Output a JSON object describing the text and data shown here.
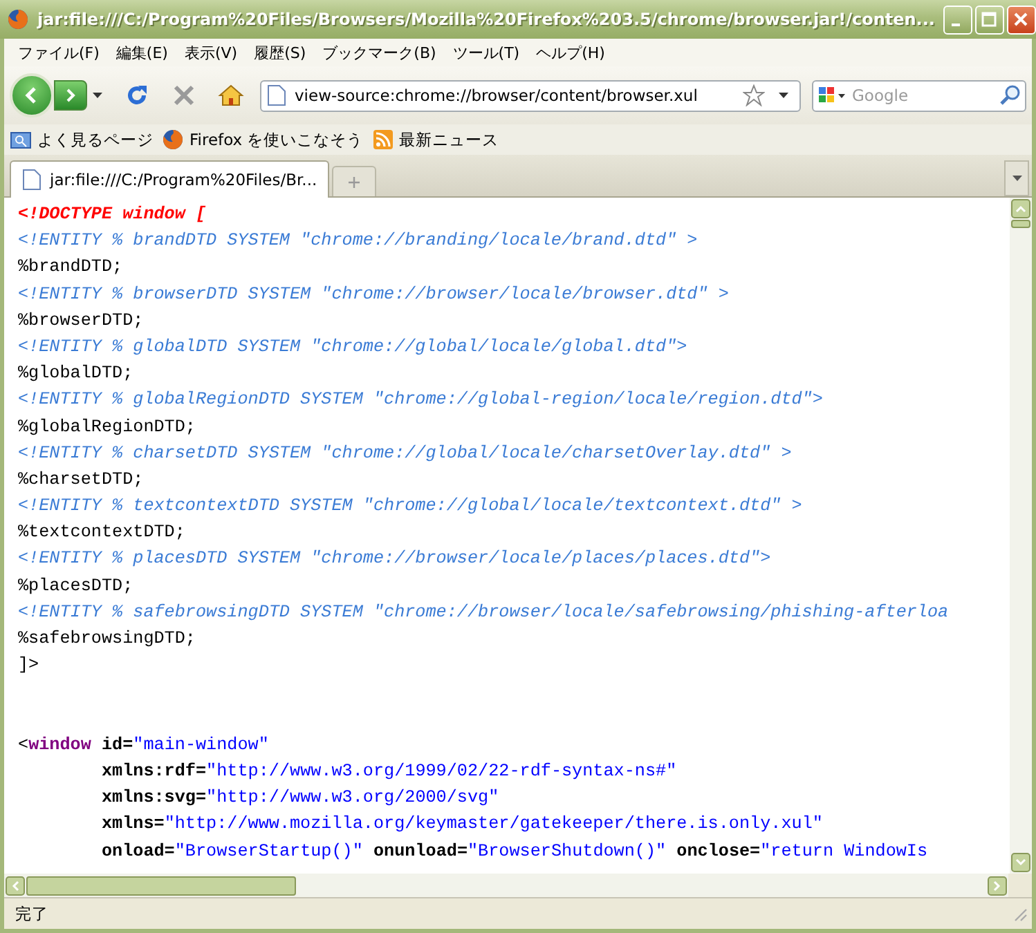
{
  "window": {
    "title": "jar:file:///C:/Program%20Files/Browsers/Mozilla%20Firefox%203.5/chrome/browser.jar!/conten..."
  },
  "menu": [
    "ファイル(F)",
    "編集(E)",
    "表示(V)",
    "履歴(S)",
    "ブックマーク(B)",
    "ツール(T)",
    "ヘルプ(H)"
  ],
  "address_bar": {
    "value": "view-source:chrome://browser/content/browser.xul"
  },
  "search": {
    "placeholder": "Google"
  },
  "bookmarks": [
    {
      "label": "よく見るページ",
      "kind": "folder"
    },
    {
      "label": "Firefox を使いこなそう",
      "kind": "firefox"
    },
    {
      "label": "最新ニュース",
      "kind": "feed"
    }
  ],
  "tabs": [
    {
      "label": "jar:file:///C:/Program%20Files/Br...",
      "selected": true
    }
  ],
  "source_lines": [
    {
      "kind": "code",
      "segments": [
        {
          "kind": "doctype",
          "text": "<!DOCTYPE window ["
        }
      ]
    },
    {
      "kind": "code",
      "segments": [
        {
          "kind": "entity",
          "text": "<!ENTITY % brandDTD SYSTEM \"chrome://branding/locale/brand.dtd\" >"
        }
      ]
    },
    {
      "kind": "code",
      "segments": [
        {
          "kind": "plain",
          "text": "%brandDTD;"
        }
      ]
    },
    {
      "kind": "code",
      "segments": [
        {
          "kind": "entity",
          "text": "<!ENTITY % browserDTD SYSTEM \"chrome://browser/locale/browser.dtd\" >"
        }
      ]
    },
    {
      "kind": "code",
      "segments": [
        {
          "kind": "plain",
          "text": "%browserDTD;"
        }
      ]
    },
    {
      "kind": "code",
      "segments": [
        {
          "kind": "entity",
          "text": "<!ENTITY % globalDTD SYSTEM \"chrome://global/locale/global.dtd\">"
        }
      ]
    },
    {
      "kind": "code",
      "segments": [
        {
          "kind": "plain",
          "text": "%globalDTD;"
        }
      ]
    },
    {
      "kind": "code",
      "segments": [
        {
          "kind": "entity",
          "text": "<!ENTITY % globalRegionDTD SYSTEM \"chrome://global-region/locale/region.dtd\">"
        }
      ]
    },
    {
      "kind": "code",
      "segments": [
        {
          "kind": "plain",
          "text": "%globalRegionDTD;"
        }
      ]
    },
    {
      "kind": "code",
      "segments": [
        {
          "kind": "entity",
          "text": "<!ENTITY % charsetDTD SYSTEM \"chrome://global/locale/charsetOverlay.dtd\" >"
        }
      ]
    },
    {
      "kind": "code",
      "segments": [
        {
          "kind": "plain",
          "text": "%charsetDTD;"
        }
      ]
    },
    {
      "kind": "code",
      "segments": [
        {
          "kind": "entity",
          "text": "<!ENTITY % textcontextDTD SYSTEM \"chrome://global/locale/textcontext.dtd\" >"
        }
      ]
    },
    {
      "kind": "code",
      "segments": [
        {
          "kind": "plain",
          "text": "%textcontextDTD;"
        }
      ]
    },
    {
      "kind": "code",
      "segments": [
        {
          "kind": "entity",
          "text": "<!ENTITY % placesDTD SYSTEM \"chrome://browser/locale/places/places.dtd\">"
        }
      ]
    },
    {
      "kind": "code",
      "segments": [
        {
          "kind": "plain",
          "text": "%placesDTD;"
        }
      ]
    },
    {
      "kind": "code",
      "segments": [
        {
          "kind": "entity",
          "text": "<!ENTITY % safebrowsingDTD SYSTEM \"chrome://browser/locale/safebrowsing/phishing-afterloa"
        }
      ]
    },
    {
      "kind": "code",
      "segments": [
        {
          "kind": "plain",
          "text": "%safebrowsingDTD;"
        }
      ]
    },
    {
      "kind": "code",
      "segments": [
        {
          "kind": "plain",
          "text": "]>"
        }
      ]
    },
    {
      "kind": "blank"
    },
    {
      "kind": "blank"
    },
    {
      "kind": "code",
      "segments": [
        {
          "kind": "plain",
          "text": "<"
        },
        {
          "kind": "tag",
          "text": "window"
        },
        {
          "kind": "attr",
          "text": " id="
        },
        {
          "kind": "value",
          "text": "\"main-window\""
        }
      ]
    },
    {
      "kind": "code",
      "segments": [
        {
          "kind": "attr",
          "text": "        xmlns:rdf="
        },
        {
          "kind": "value",
          "text": "\"http://www.w3.org/1999/02/22-rdf-syntax-ns#\""
        }
      ]
    },
    {
      "kind": "code",
      "segments": [
        {
          "kind": "attr",
          "text": "        xmlns:svg="
        },
        {
          "kind": "value",
          "text": "\"http://www.w3.org/2000/svg\""
        }
      ]
    },
    {
      "kind": "code",
      "segments": [
        {
          "kind": "attr",
          "text": "        xmlns="
        },
        {
          "kind": "value",
          "text": "\"http://www.mozilla.org/keymaster/gatekeeper/there.is.only.xul\""
        }
      ]
    },
    {
      "kind": "code",
      "segments": [
        {
          "kind": "attr",
          "text": "        onload="
        },
        {
          "kind": "value",
          "text": "\"BrowserStartup()\""
        },
        {
          "kind": "attr",
          "text": " onunload="
        },
        {
          "kind": "value",
          "text": "\"BrowserShutdown()\""
        },
        {
          "kind": "attr",
          "text": " onclose="
        },
        {
          "kind": "value",
          "text": "\"return WindowIs"
        }
      ]
    }
  ],
  "status_bar": {
    "text": "完了"
  }
}
